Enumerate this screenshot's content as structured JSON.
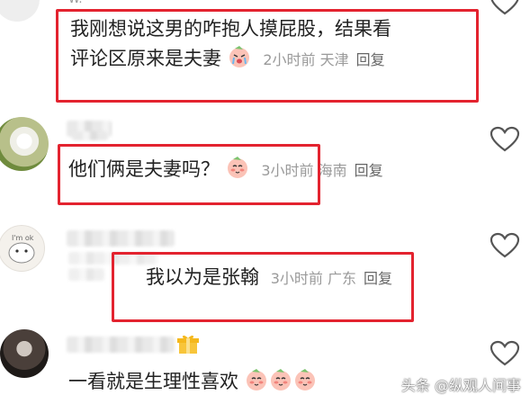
{
  "comments": [
    {
      "username": "W.",
      "text_line1": "我刚想说这男的咋抱人摸屁股，结果看",
      "text_line2": "评论区原来是夫妻",
      "time": "2小时前",
      "location": "天津",
      "reply_label": "回复"
    },
    {
      "text": "他们俩是夫妻吗？",
      "time": "3小时前",
      "location": "海南",
      "reply_label": "回复"
    },
    {
      "text": "我以为是张翰",
      "time": "3小时前",
      "location": "广东",
      "reply_label": "回复"
    },
    {
      "text": "一看就是生理性喜欢"
    }
  ],
  "watermark": "头条 @纵观人间事",
  "icons": {
    "like": "heart-outline-icon",
    "emoji_crying": "crying-peach-emoji",
    "emoji_shy": "shy-peach-emoji",
    "badge": "gift-badge-icon"
  },
  "colors": {
    "highlight": "#e3232f",
    "meta_text": "#9a9a9a",
    "body_text": "#222222"
  }
}
